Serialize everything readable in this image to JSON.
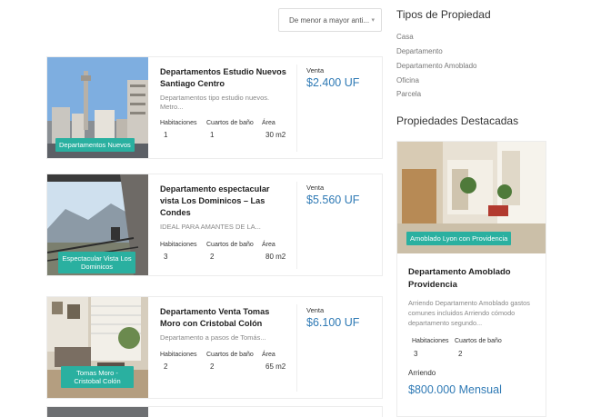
{
  "sort": {
    "selected": "De menor a mayor anti...",
    "chevron": "▾"
  },
  "labels": {
    "habitaciones": "Habitaciones",
    "banos": "Cuartos de baño",
    "area": "Área"
  },
  "listings": [
    {
      "title": "Departamentos Estudio Nuevos Santiago Centro",
      "desc": "Departamentos tipo estudio nuevos. Metro...",
      "badge": "Departamentos Nuevos",
      "rooms": "1",
      "baths": "1",
      "area": "30 m2",
      "operation": "Venta",
      "price": "$2.400 UF"
    },
    {
      "title": "Departamento espectacular vista Los Dominicos – Las Condes",
      "desc": "IDEAL PARA AMANTES DE LA...",
      "badge": "Espectacular Vista Los Dominicos",
      "rooms": "3",
      "baths": "2",
      "area": "80 m2",
      "operation": "Venta",
      "price": "$5.560 UF"
    },
    {
      "title": "Departamento Venta Tomas Moro con Cristobal Colón",
      "desc": "Departamento a pasos de Tomás...",
      "badge": "Tomas Moro - Cristobal Colón",
      "rooms": "2",
      "baths": "2",
      "area": "65 m2",
      "operation": "Venta",
      "price": "$6.100 UF"
    }
  ],
  "sidebar": {
    "types_heading": "Tipos de Propiedad",
    "types": [
      "Casa",
      "Departamento",
      "Departamento Amoblado",
      "Oficina",
      "Parcela"
    ],
    "featured_heading": "Propiedades Destacadas",
    "featured": {
      "badge": "Amoblado Lyon con Providencia",
      "title": "Departamento Amoblado Providencia",
      "desc": "Arriendo Departamento Amoblado gastos comunes incluidos Arriendo cómodo departamento segundo...",
      "rooms": "3",
      "baths": "2",
      "operation": "Arriendo",
      "price": "$800.000 Mensual"
    }
  },
  "colors": {
    "accent": "#2ab0a0",
    "price": "#2f7ab5"
  }
}
